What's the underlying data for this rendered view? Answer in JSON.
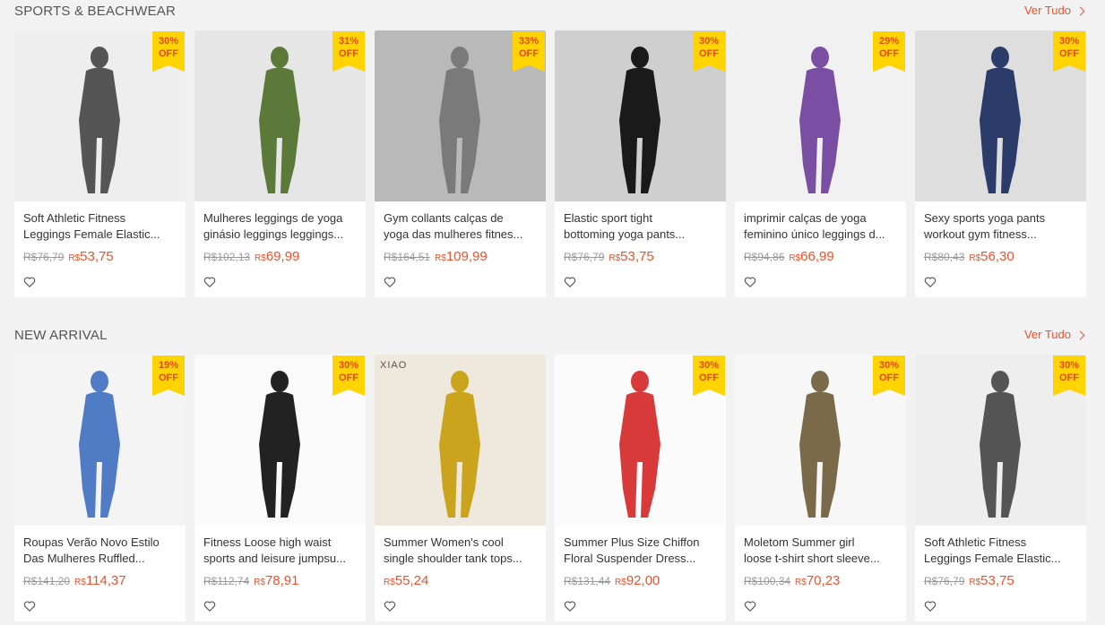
{
  "sections": [
    {
      "title": "SPORTS & BEACHWEAR",
      "view_all": "Ver Tudo",
      "products": [
        {
          "name_l1": "Soft Athletic Fitness",
          "name_l2": "Leggings Female Elastic...",
          "old_price": "R$76,79",
          "currency": "R$",
          "price": "53,75",
          "discount_pct": "30%",
          "discount_off": "OFF",
          "bg": "#eeeeee",
          "fg": "#555555",
          "icon": "leggings-gray-photo"
        },
        {
          "name_l1": "Mulheres leggings de yoga",
          "name_l2": "ginásio leggings leggings...",
          "old_price": "R$102,13",
          "currency": "R$",
          "price": "69,99",
          "discount_pct": "31%",
          "discount_off": "OFF",
          "bg": "#e6e6e6",
          "fg": "#5b7a3a",
          "icon": "leggings-green-photo"
        },
        {
          "name_l1": "Gym collants calças de",
          "name_l2": "yoga das mulheres fitnes...",
          "old_price": "R$164,51",
          "currency": "R$",
          "price": "109,99",
          "discount_pct": "33%",
          "discount_off": "OFF",
          "bg": "#b9b9b9",
          "fg": "#7a7a7a",
          "icon": "leggings-textured-photo"
        },
        {
          "name_l1": "Elastic sport tight",
          "name_l2": "bottoming yoga pants...",
          "old_price": "R$76,79",
          "currency": "R$",
          "price": "53,75",
          "discount_pct": "30%",
          "discount_off": "OFF",
          "bg": "#cfcfcf",
          "fg": "#1a1a1a",
          "icon": "leggings-black-gym-photo"
        },
        {
          "name_l1": "imprimir calças de yoga",
          "name_l2": "feminino único leggings d...",
          "old_price": "R$94,86",
          "currency": "R$",
          "price": "66,99",
          "discount_pct": "29%",
          "discount_off": "OFF",
          "bg": "#f1f1f1",
          "fg": "#7a4ea3",
          "icon": "leggings-print-photo"
        },
        {
          "name_l1": "Sexy sports yoga pants",
          "name_l2": "workout gym fitness...",
          "old_price": "R$80,43",
          "currency": "R$",
          "price": "56,30",
          "discount_pct": "30%",
          "discount_off": "OFF",
          "bg": "#dedede",
          "fg": "#2b3c6b",
          "icon": "leggings-striped-photo"
        }
      ]
    },
    {
      "title": "NEW ARRIVAL",
      "view_all": "Ver Tudo",
      "products": [
        {
          "name_l1": "Roupas Verão Novo Estilo",
          "name_l2": "Das Mulheres Ruffled...",
          "old_price": "R$141,20",
          "currency": "R$",
          "price": "114,37",
          "discount_pct": "19%",
          "discount_off": "OFF",
          "bg": "#f4f4f4",
          "fg": "#4f7cc4",
          "icon": "blue-dress-photo"
        },
        {
          "name_l1": "Fitness Loose high waist",
          "name_l2": "sports and leisure jumpsu...",
          "old_price": "R$112,74",
          "currency": "R$",
          "price": "78,91",
          "discount_pct": "30%",
          "discount_off": "OFF",
          "bg": "#fafafa",
          "fg": "#222222",
          "icon": "black-jumpsuit-photo"
        },
        {
          "name_l1": "Summer Women's cool",
          "name_l2": "single shoulder tank tops...",
          "old_price": "",
          "currency": "R$",
          "price": "55,24",
          "discount_pct": "",
          "discount_off": "",
          "bg": "#efe8dd",
          "fg": "#c9a41c",
          "icon": "yellow-top-photo",
          "brand": "XIAO"
        },
        {
          "name_l1": "Summer Plus Size Chiffon",
          "name_l2": "Floral Suspender Dress...",
          "old_price": "R$131,44",
          "currency": "R$",
          "price": "92,00",
          "discount_pct": "30%",
          "discount_off": "OFF",
          "bg": "#fbfbfb",
          "fg": "#d83a3a",
          "icon": "floral-dress-photo"
        },
        {
          "name_l1": "Moletom Summer girl",
          "name_l2": "loose t-shirt short sleeve...",
          "old_price": "R$100,34",
          "currency": "R$",
          "price": "70,23",
          "discount_pct": "30%",
          "discount_off": "OFF",
          "bg": "#f7f7f7",
          "fg": "#7a6a4a",
          "icon": "hoodie-shorts-photo"
        },
        {
          "name_l1": "Soft Athletic Fitness",
          "name_l2": "Leggings Female Elastic...",
          "old_price": "R$76,79",
          "currency": "R$",
          "price": "53,75",
          "discount_pct": "30%",
          "discount_off": "OFF",
          "bg": "#eeeeee",
          "fg": "#555555",
          "icon": "leggings-gray-photo"
        }
      ]
    }
  ]
}
